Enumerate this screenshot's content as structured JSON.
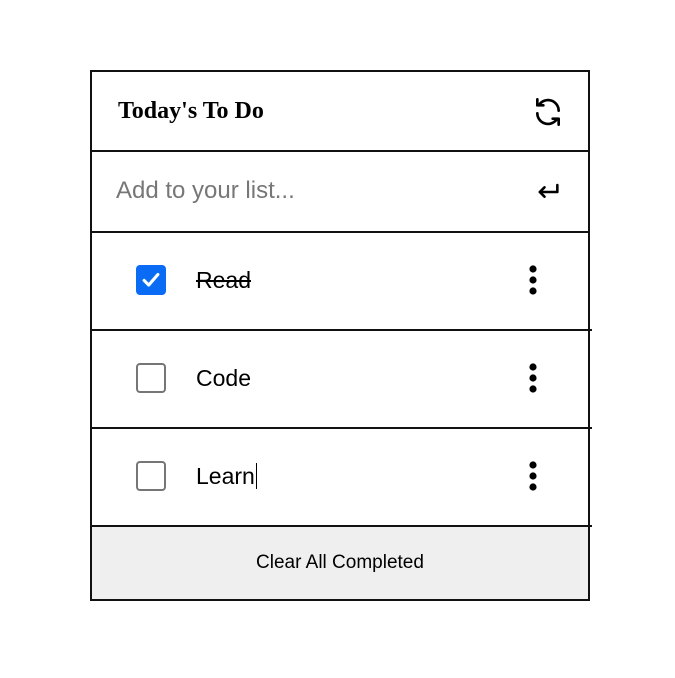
{
  "header": {
    "title": "Today's To Do",
    "refresh_icon": "refresh-icon"
  },
  "input": {
    "placeholder": "Add to your list...",
    "value": "",
    "enter_icon": "enter-return-icon"
  },
  "items": [
    {
      "label": "Read",
      "completed": true,
      "menu_icon": "more-vertical-icon"
    },
    {
      "label": "Code",
      "completed": false,
      "menu_icon": "more-vertical-icon"
    },
    {
      "label": "Learn",
      "completed": false,
      "editing": true,
      "menu_icon": "more-vertical-icon"
    }
  ],
  "footer": {
    "clear_label": "Clear All Completed"
  },
  "colors": {
    "accent": "#0a6cf5",
    "border": "#111111",
    "footer_bg": "#efefef",
    "placeholder": "#777777"
  }
}
